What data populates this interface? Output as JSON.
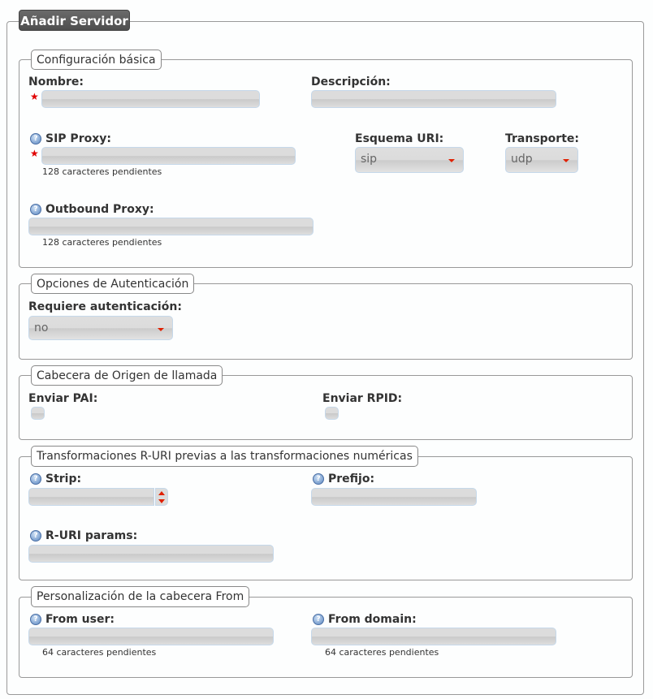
{
  "title": "Añadir Servidor",
  "sections": {
    "basic": {
      "legend": "Configuración básica",
      "nombre_label": "Nombre:",
      "descripcion_label": "Descripción:",
      "sip_proxy_label": "SIP Proxy:",
      "sip_proxy_hint": "128 caracteres pendientes",
      "esquema_label": "Esquema URI:",
      "esquema_value": "sip",
      "transporte_label": "Transporte:",
      "transporte_value": "udp",
      "outbound_label": "Outbound Proxy:",
      "outbound_hint": "128 caracteres pendientes"
    },
    "auth": {
      "legend": "Opciones de Autenticación",
      "requiere_label": "Requiere autenticación:",
      "requiere_value": "no"
    },
    "caller": {
      "legend": "Cabecera de Origen de llamada",
      "pai_label": "Enviar PAI:",
      "rpid_label": "Enviar RPID:"
    },
    "ruri": {
      "legend": "Transformaciones R-URI previas a las transformaciones numéricas",
      "strip_label": "Strip:",
      "prefijo_label": "Prefijo:",
      "params_label": "R-URI params:"
    },
    "from": {
      "legend": "Personalización de la cabecera From",
      "user_label": "From user:",
      "user_hint": "64 caracteres pendientes",
      "domain_label": "From domain:",
      "domain_hint": "64 caracteres pendientes"
    }
  },
  "colors": {
    "required_star": "#e00000",
    "legend_bg": "#5a5a5a",
    "input_border": "#c5d8ea",
    "arrow": "#e02000"
  }
}
